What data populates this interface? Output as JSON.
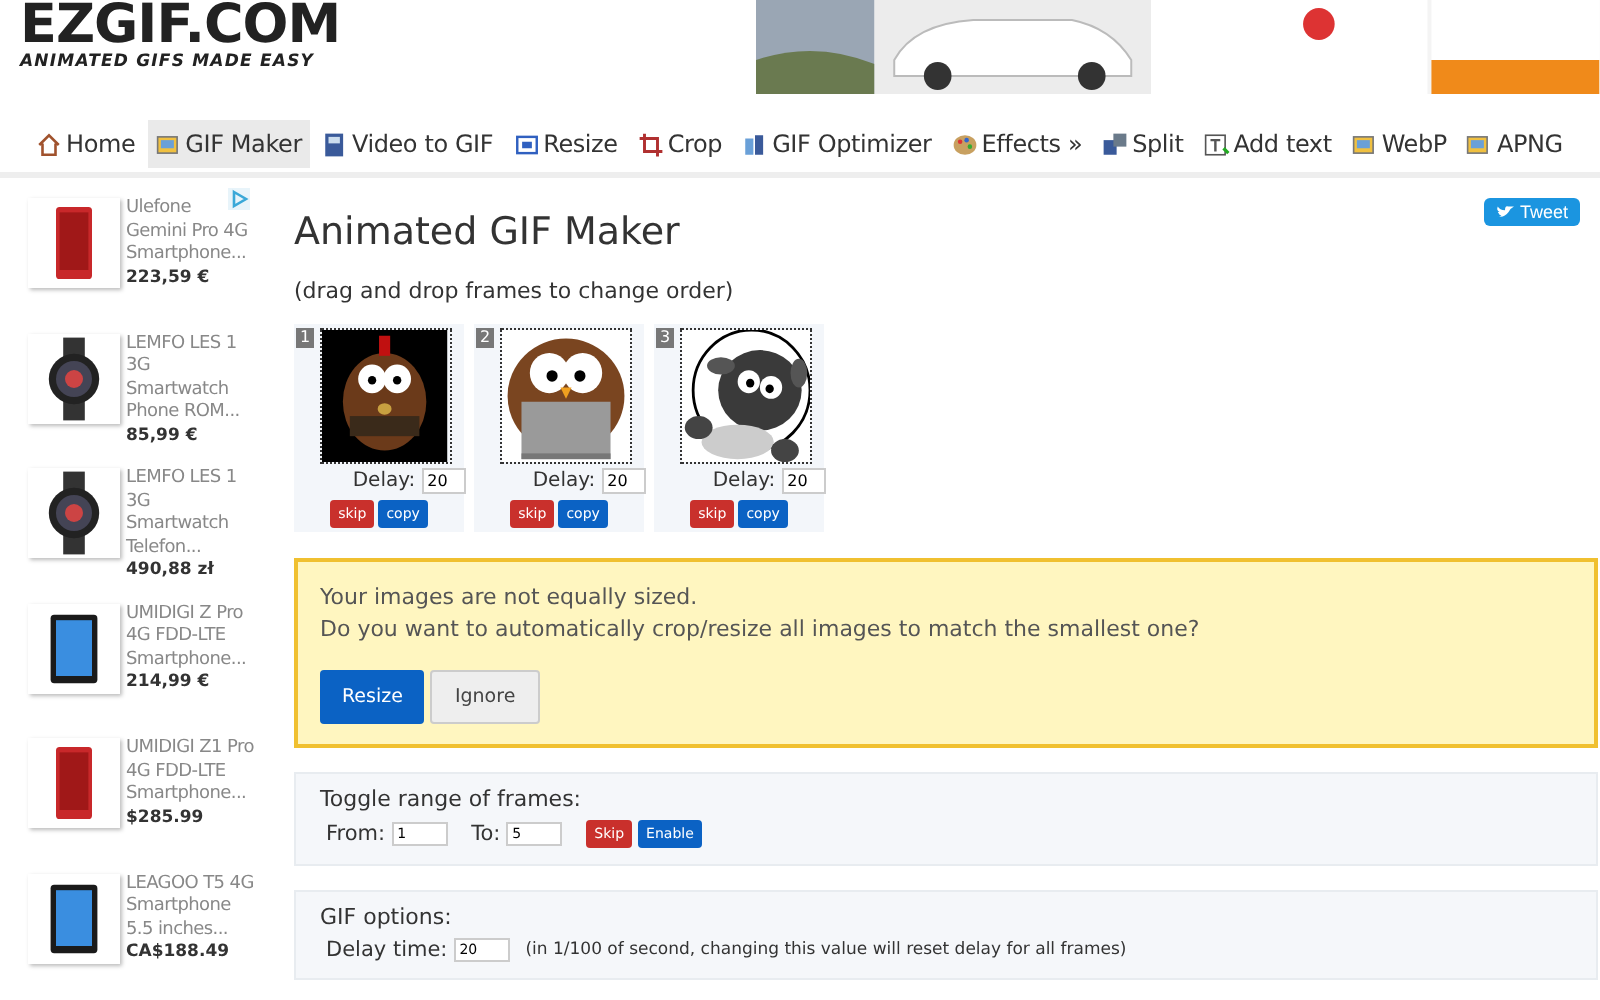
{
  "logo": {
    "title": "EZGIF.COM",
    "tagline": "ANIMATED GIFS MADE EASY"
  },
  "nav": [
    {
      "label": "Home",
      "selected": false
    },
    {
      "label": "GIF Maker",
      "selected": true
    },
    {
      "label": "Video to GIF",
      "selected": false
    },
    {
      "label": "Resize",
      "selected": false
    },
    {
      "label": "Crop",
      "selected": false
    },
    {
      "label": "GIF Optimizer",
      "selected": false
    },
    {
      "label": "Effects »",
      "selected": false
    },
    {
      "label": "Split",
      "selected": false
    },
    {
      "label": "Add text",
      "selected": false
    },
    {
      "label": "WebP",
      "selected": false
    },
    {
      "label": "APNG",
      "selected": false
    }
  ],
  "ads": [
    {
      "title": "Ulefone Gemini Pro 4G Smartphone...",
      "price": "223,59 €"
    },
    {
      "title": "LEMFO LES 1 3G Smartwatch Phone ROM...",
      "price": "85,99 €"
    },
    {
      "title": "LEMFO LES 1 3G Smartwatch Telefon...",
      "price": "490,88 zł"
    },
    {
      "title": "UMIDIGI Z Pro 4G FDD-LTE Smartphone...",
      "price": "214,99 €"
    },
    {
      "title": "UMIDIGI Z1 Pro 4G FDD-LTE Smartphone...",
      "price": "$285.99"
    },
    {
      "title": "LEAGOO T5 4G Smartphone 5.5 inches...",
      "price": "CA$188.49"
    }
  ],
  "tweet": "Tweet",
  "title": "Animated GIF Maker",
  "subtitle": "(drag and drop frames to change order)",
  "frames": [
    {
      "number": "1",
      "delay_label": "Delay:",
      "delay": "20",
      "skip": "skip",
      "copy": "copy"
    },
    {
      "number": "2",
      "delay_label": "Delay:",
      "delay": "20",
      "skip": "skip",
      "copy": "copy"
    },
    {
      "number": "3",
      "delay_label": "Delay:",
      "delay": "20",
      "skip": "skip",
      "copy": "copy"
    }
  ],
  "notice": {
    "lines": [
      "Your images are not equally sized.",
      "Do you want to automatically crop/resize all images to match the smallest one?"
    ],
    "resize": "Resize",
    "ignore": "Ignore"
  },
  "toggle": {
    "title": "Toggle range of frames:",
    "from_label": "From:",
    "from": "1",
    "to_label": "To:",
    "to": "5",
    "skip": "Skip",
    "enable": "Enable"
  },
  "options": {
    "title": "GIF options:",
    "delay_label": "Delay time:",
    "delay": "20",
    "note": "(in 1/100 of second, changing this value will reset delay for all frames)"
  }
}
